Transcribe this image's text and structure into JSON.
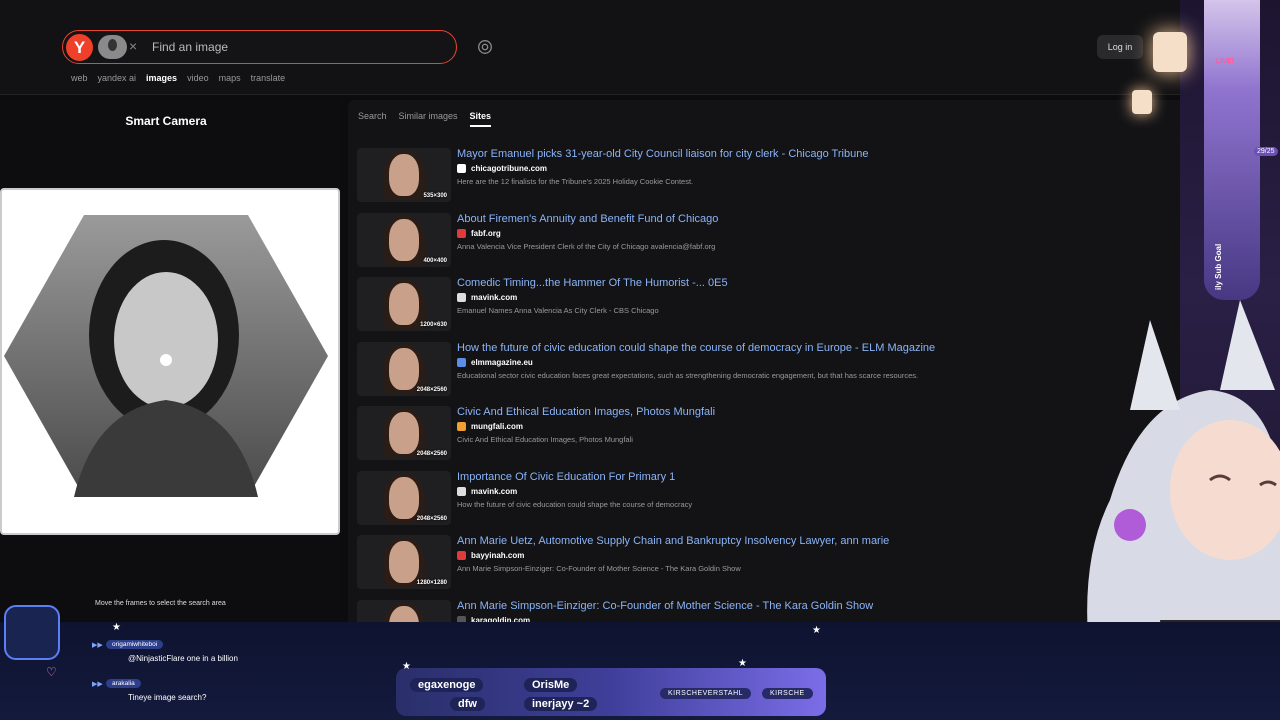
{
  "search": {
    "logo": "Y",
    "placeholder": "Find an image",
    "clear": "×"
  },
  "header": {
    "login": "Log in",
    "nav": [
      "web",
      "yandex ai",
      "images",
      "video",
      "maps",
      "translate"
    ],
    "active_nav": "images"
  },
  "left": {
    "title": "Smart Camera",
    "hint": "Move the frames to select the search area"
  },
  "tabs": [
    "Search",
    "Similar images",
    "Sites"
  ],
  "active_tab": "Sites",
  "results": [
    {
      "title": "Mayor Emanuel picks 31-year-old City Council liaison for city clerk - Chicago Tribune",
      "site": "chicagotribune.com",
      "desc": "Here are the 12 finalists for the Tribune's 2025 Holiday Cookie Contest.",
      "dim": "535×300",
      "fav": "#ffffff"
    },
    {
      "title": "About Firemen's Annuity and Benefit Fund of Chicago",
      "site": "fabf.org",
      "desc": "Anna Valencia Vice President Clerk of the City of Chicago avalencia@fabf.org",
      "dim": "400×400",
      "fav": "#e03a3a"
    },
    {
      "title": "Comedic Timing...the Hammer Of The Humorist -... 0E5",
      "site": "mavink.com",
      "desc": "Emanuel Names Anna Valencia As City Clerk - CBS Chicago",
      "dim": "1200×630",
      "fav": "#dddddd"
    },
    {
      "title": "How the future of civic education could shape the course of democracy in Europe - ELM Magazine",
      "site": "elmmagazine.eu",
      "desc": "Educational sector civic education faces great expectations, such as strengthening democratic engagement, but that has scarce resources.",
      "dim": "2048×2560",
      "fav": "#5b8ee6"
    },
    {
      "title": "Civic And Ethical Education Images, Photos Mungfali",
      "site": "mungfali.com",
      "desc": "Civic And Ethical Education Images, Photos Mungfali",
      "dim": "2048×2560",
      "fav": "#f0a030"
    },
    {
      "title": "Importance Of Civic Education For Primary 1",
      "site": "mavink.com",
      "desc": "How the future of civic education could shape the course of democracy",
      "dim": "2048×2560",
      "fav": "#dddddd"
    },
    {
      "title": "Ann Marie Uetz, Automotive Supply Chain and Bankruptcy Insolvency Lawyer, ann marie",
      "site": "bayyinah.com",
      "desc": "Ann Marie Simpson-Einziger: Co-Founder of Mother Science - The Kara Goldin Show",
      "dim": "1280×1280",
      "fav": "#e03a3a"
    },
    {
      "title": "Ann Marie Simpson-Einziger: Co-Founder of Mother Science - The Kara Goldin Show",
      "site": "karagoldin.com",
      "desc": "",
      "dim": "",
      "fav": "#555555"
    }
  ],
  "stream": {
    "live": "LIVE!",
    "goal_count": "29/25",
    "goal_label": "ily Sub Goal",
    "chat": [
      {
        "user": "origamiwhiteboi",
        "msg": "@NinjasticFlare one in a billion"
      },
      {
        "user": "arakalia",
        "msg": "Tineye image search?"
      }
    ],
    "ticker": [
      "egaxenoge",
      "OrisMe",
      "dfw",
      "inerjayy ~2"
    ],
    "socials": [
      "KIRSCHEVERSTAHL",
      "KIRSCHE"
    ]
  },
  "colors": {
    "accent": "#e8452f",
    "link": "#8ab4f8",
    "stream_purple": "#7b6de8"
  }
}
